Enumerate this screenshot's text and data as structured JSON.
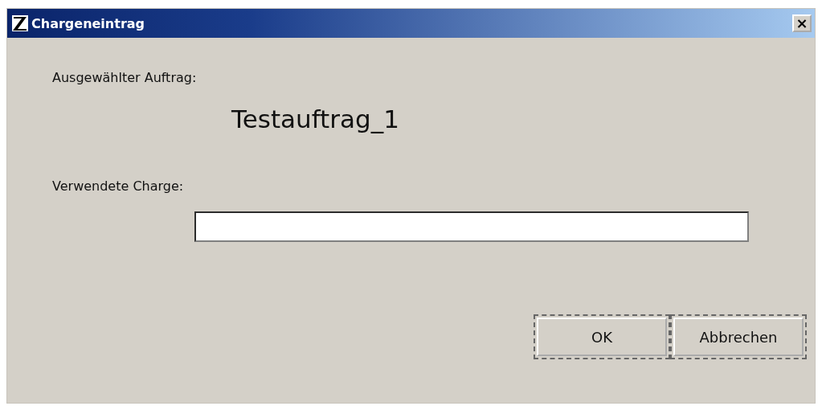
{
  "window": {
    "title": "Chargeneintrag",
    "close": "×"
  },
  "order_label": "Ausgewählter Auftrag:",
  "order_value": "Testauftrag_1",
  "charge_label": "Verwendete Charge:",
  "buttons": [
    "OK",
    "Abbrechen"
  ]
}
